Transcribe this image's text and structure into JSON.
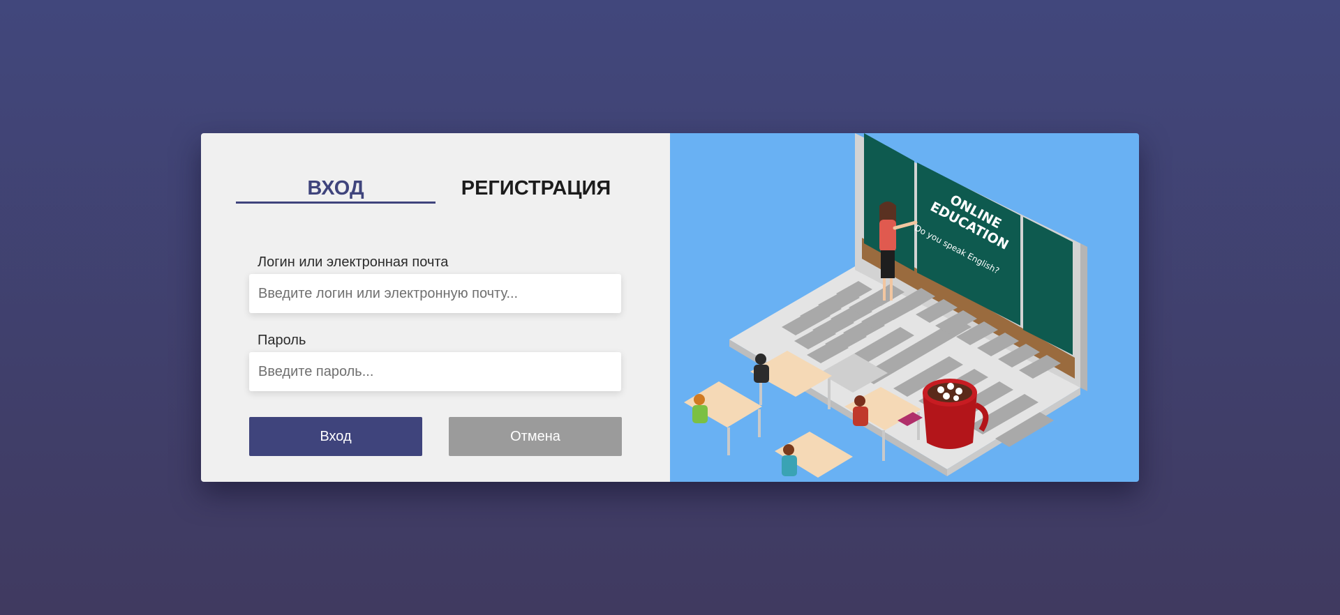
{
  "tabs": {
    "login": "ВХОД",
    "register": "РЕГИСТРАЦИЯ"
  },
  "form": {
    "login_label": "Логин или электронная почта",
    "login_placeholder": "Введите логин или электронную почту...",
    "password_label": "Пароль",
    "password_placeholder": "Введите пароль..."
  },
  "buttons": {
    "submit": "Вход",
    "cancel": "Отмена"
  },
  "illustration": {
    "board_title_line1": "ONLINE",
    "board_title_line2": "EDUCATION",
    "board_subtitle": "Do you speak English?"
  },
  "colors": {
    "accent": "#3f447c",
    "cancel": "#9b9b9b",
    "panel": "#f0f0f0",
    "illustration_bg": "#69b1f3"
  }
}
